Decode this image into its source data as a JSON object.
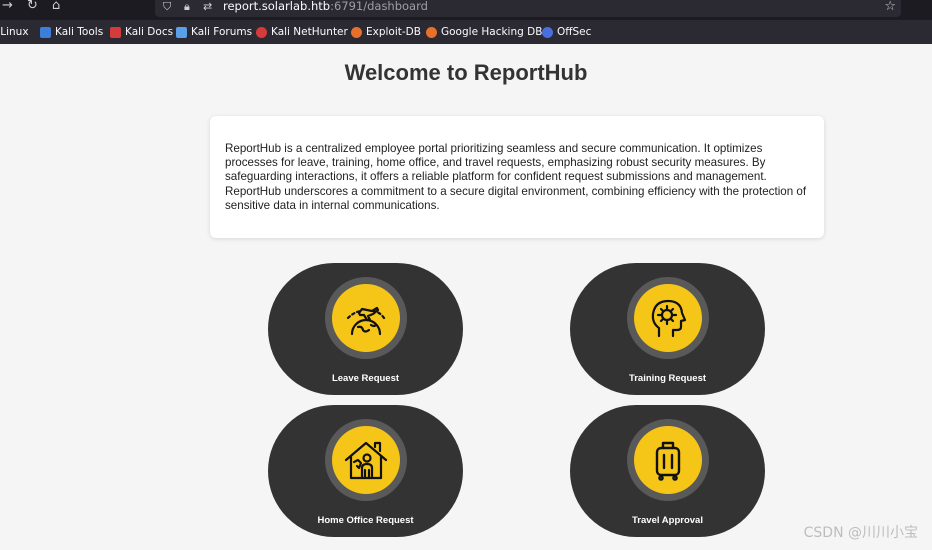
{
  "browser": {
    "url_host": "report.solarlab.htb",
    "url_rest": ":6791/dashboard",
    "bookmarks": [
      {
        "label": "i Linux",
        "color": "#2a6ebb"
      },
      {
        "label": "Kali Tools",
        "color": "#3d7edb"
      },
      {
        "label": "Kali Docs",
        "color": "#d43c3c"
      },
      {
        "label": "Kali Forums",
        "color": "#5aa0e6"
      },
      {
        "label": "Kali NetHunter",
        "color": "#d43c3c"
      },
      {
        "label": "Exploit-DB",
        "color": "#e8702a"
      },
      {
        "label": "Google Hacking DB",
        "color": "#e8702a"
      },
      {
        "label": "OffSec",
        "color": "#4a6fdc"
      }
    ]
  },
  "page": {
    "title": "Welcome to ReportHub",
    "description": "ReportHub is a centralized employee portal prioritizing seamless and secure communication. It optimizes processes for leave, training, home office, and travel requests, emphasizing robust security measures. By safeguarding interactions, it offers a reliable platform for confident request submissions and management. ReportHub underscores a commitment to a secure digital environment, combining efficiency with the protection of sensitive data in internal communications."
  },
  "tiles": [
    {
      "label": "Leave Request",
      "icon": "plane-globe-icon"
    },
    {
      "label": "Training Request",
      "icon": "brain-head-icon"
    },
    {
      "label": "Home Office Request",
      "icon": "house-person-icon"
    },
    {
      "label": "Travel Approval",
      "icon": "suitcase-icon"
    }
  ],
  "watermark": "CSDN @川川小宝",
  "colors": {
    "accent": "#f5c518",
    "tile": "#333333",
    "ring": "#595959"
  }
}
